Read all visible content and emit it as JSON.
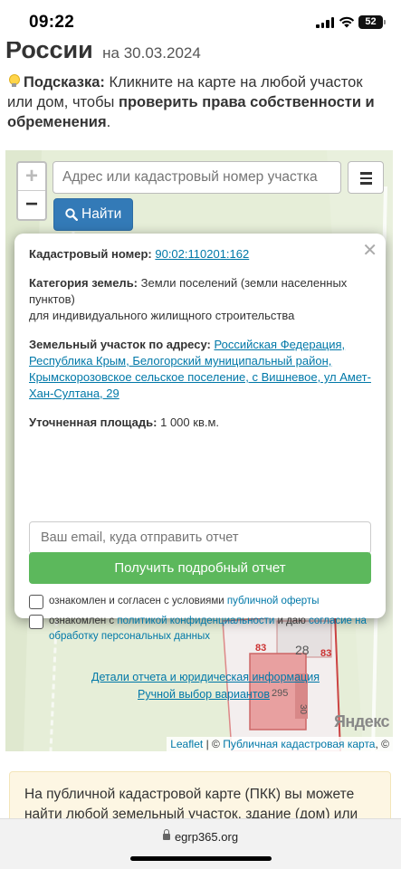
{
  "status_bar": {
    "time": "09:22",
    "battery": "52"
  },
  "header": {
    "title_fragment": "России",
    "date_text": "на 30.03.2024"
  },
  "hint": {
    "label": "Подсказка:",
    "text1": " Кликните на карте на любой участок или дом, чтобы ",
    "bold_text": "проверить права собственности и обременения",
    "text2": "."
  },
  "map": {
    "zoom_in": "+",
    "zoom_out": "−",
    "search_placeholder": "Адрес или кадастровый номер участка",
    "find_button": "Найти",
    "parcel_labels": [
      "83",
      "28",
      "83",
      "295",
      "30"
    ],
    "yandex_logo": "Яндекс",
    "attribution": {
      "leaflet": "Leaflet",
      "separator": " | © ",
      "pkk": "Публичная кадастровая карта",
      "suffix": ", ©"
    }
  },
  "popup": {
    "close": "✕",
    "cadastral_label": "Кадастровый номер:",
    "cadastral_number": "90:02:110201:162",
    "category_label": "Категория земель:",
    "category_value": "Земли поселений (земли населенных пунктов)",
    "category_use": "для индивидуального жилищного строительства",
    "address_label": "Земельный участок по адресу:",
    "address_value": "Российская Федерация, Республика Крым, Белогорский муниципальный район, Крымскорозовское сельское поселение, с Вишневое, ул Амет-Хан-Султана, 29",
    "area_label": "Уточненная площадь:",
    "area_value": "1 000 кв.м.",
    "email_placeholder": "Ваш email, куда отправить отчет",
    "report_button": "Получить подробный отчет",
    "consent1_text": "ознакомлен и согласен с условиями ",
    "consent1_link": "публичной оферты",
    "consent2_text1": "ознакомлен с ",
    "consent2_link1": "политикой конфиденциальности",
    "consent2_text2": " и даю ",
    "consent2_link2": "согласие на обработку персональных данных",
    "link_details": "Детали отчета и юридическая информация",
    "link_manual": "Ручной выбор вариантов"
  },
  "info": {
    "text": "На публичной кадастровой карте (ПКК) вы можете найти любой земельный участок, здание (дом) или"
  },
  "browser": {
    "url": "egrp365.org"
  }
}
